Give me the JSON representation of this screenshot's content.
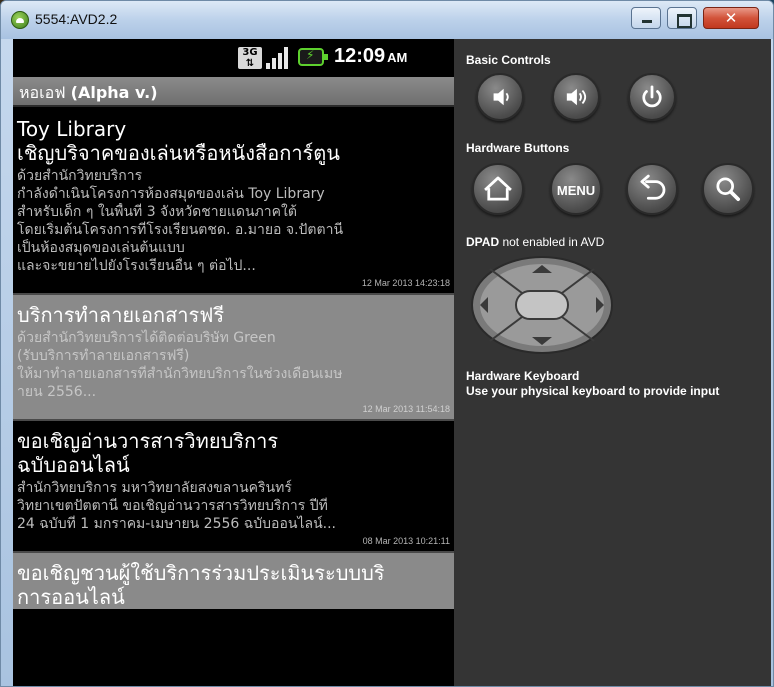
{
  "window": {
    "title": "5554:AVD2.2",
    "close_glyph": "✕"
  },
  "status_bar": {
    "network": "3G",
    "time": "12:09",
    "ampm": "AM"
  },
  "app": {
    "title_prefix": "หอเอฟ",
    "title_suffix": "(Alpha v.)"
  },
  "feed": [
    {
      "headline": [
        "Toy Library",
        "เชิญบริจาคของเล่นหรือหนังสือการ์ตูน"
      ],
      "body": [
        "ด้วยสำนักวิทยบริการ",
        "กำลังดำเนินโครงการห้องสมุดของเล่น Toy Library",
        "สำหรับเด็ก ๆ ในพื้นที่ 3 จังหวัดชายแดนภาคใต้",
        "โดยเริ่มต้นโครงการที่โรงเรียนตชด. อ.มายอ จ.ปัตตานี",
        "เป็นห้องสมุดของเล่นต้นแบบ",
        "และจะขยายไปยังโรงเรียนอื่น ๆ ต่อไป..."
      ],
      "date": "12 Mar 2013 14:23:18",
      "style": "dark"
    },
    {
      "headline": [
        "บริการทำลายเอกสารฟรี"
      ],
      "body": [
        "ด้วยสำนักวิทยบริการได้ติดต่อบริษัท Green",
        "(รับบริการทำลายเอกสารฟรี)",
        "ให้มาทำลายเอกสารที่สำนักวิทยบริการในช่วงเดือนเมษ",
        "ายน 2556..."
      ],
      "date": "12 Mar 2013 11:54:18",
      "style": "light"
    },
    {
      "headline": [
        "ขอเชิญอ่านวารสารวิทยบริการ",
        "ฉบับออนไลน์"
      ],
      "body": [
        "สำนักวิทยบริการ มหาวิทยาลัยสงขลานครินทร์",
        "วิทยาเขตปัตตานี ขอเชิญอ่านวารสารวิทยบริการ ปีที่",
        "24 ฉบับที่ 1 มกราคม-เมษายน 2556 ฉบับออนไลน์..."
      ],
      "date": "08 Mar 2013 10:21:11",
      "style": "dark"
    },
    {
      "headline": [
        "ขอเชิญชวนผู้ใช้บริการร่วมประเมินระบบบริ",
        "การออนไลน์"
      ],
      "body": [],
      "date": "",
      "style": "light"
    }
  ],
  "controls": {
    "basic_label": "Basic Controls",
    "hardware_label": "Hardware Buttons",
    "menu_label": "MENU",
    "dpad_label_bold": "DPAD",
    "dpad_label_rest": " not enabled in AVD",
    "keyboard_title": "Hardware Keyboard",
    "keyboard_hint": "Use your physical keyboard to provide input"
  }
}
